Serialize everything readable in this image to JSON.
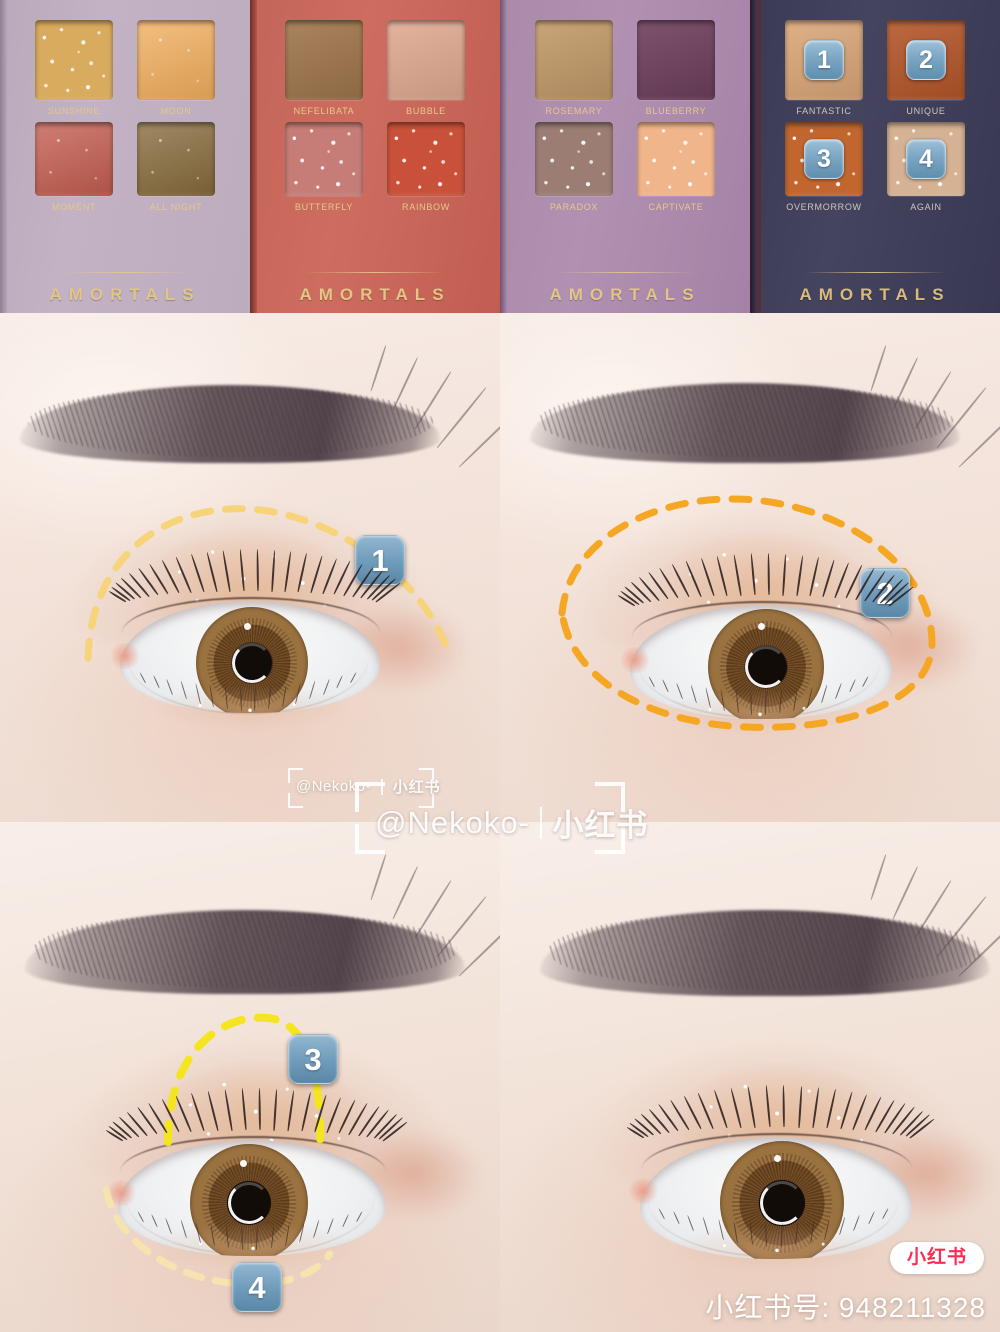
{
  "brand": "AMORTALS",
  "palettes": [
    {
      "case_color": "#bcacbe",
      "shades": [
        {
          "name": "SUNSHINE",
          "color": "#d9ab5e",
          "finish": "glitter"
        },
        {
          "name": "MOON",
          "color": "#f0ad5c",
          "finish": "shimmer"
        },
        {
          "name": "MOMENT",
          "color": "#c25b4e",
          "finish": "shimmer"
        },
        {
          "name": "ALL NIGHT",
          "color": "#85693a",
          "finish": "shimmer"
        }
      ]
    },
    {
      "case_color": "#c4655a",
      "shades": [
        {
          "name": "NEFELIBATA",
          "color": "#a0764c",
          "finish": "matte"
        },
        {
          "name": "BUBBLE",
          "color": "#e2ab92",
          "finish": "matte"
        },
        {
          "name": "BUTTERFLY",
          "color": "#c67d77",
          "finish": "glitter"
        },
        {
          "name": "RAINBOW",
          "color": "#c9513a",
          "finish": "glitter"
        }
      ]
    },
    {
      "case_color": "#a98aaa",
      "shades": [
        {
          "name": "ROSEMARY",
          "color": "#c39a6a",
          "finish": "matte"
        },
        {
          "name": "BLUEBERRY",
          "color": "#6e3f5c",
          "finish": "matte"
        },
        {
          "name": "PARADOX",
          "color": "#9c7d74",
          "finish": "glitter"
        },
        {
          "name": "CAPTIVATE",
          "color": "#f0b58a",
          "finish": "glitter"
        }
      ]
    },
    {
      "case_color": "#3b3a56",
      "shades": [
        {
          "name": "FANTASTIC",
          "color": "#dca87a",
          "finish": "matte",
          "step": "1"
        },
        {
          "name": "UNIQUE",
          "color": "#b5572a",
          "finish": "matte",
          "step": "2"
        },
        {
          "name": "OVERMORROW",
          "color": "#c1662f",
          "finish": "glitter",
          "step": "3"
        },
        {
          "name": "AGAIN",
          "color": "#d5b293",
          "finish": "glitter",
          "step": "4"
        }
      ]
    }
  ],
  "steps": [
    {
      "number": "1",
      "guide_color": "#f7d47a",
      "guide_shape": "upper-arc",
      "shade": "FANTASTIC"
    },
    {
      "number": "2",
      "guide_color": "#f5a623",
      "guide_shape": "full-ellipse",
      "shade": "UNIQUE"
    },
    {
      "number": "3",
      "guide_color": "#f5e520",
      "guide_shape": "center-dome",
      "shade": "OVERMORROW"
    },
    {
      "number": "4",
      "guide_color": "#f5e3b0",
      "guide_shape": "lower-arc",
      "shade": "AGAIN"
    }
  ],
  "watermarks": {
    "handle": "@Nekoko-",
    "platform": "小红书",
    "badge": "小红书",
    "user_id_label": "小红书号: 948211328"
  },
  "colors": {
    "badge_blue": "#74a0bf",
    "brand_gold": "#e3c585",
    "xhs_red": "#fe2c55"
  }
}
